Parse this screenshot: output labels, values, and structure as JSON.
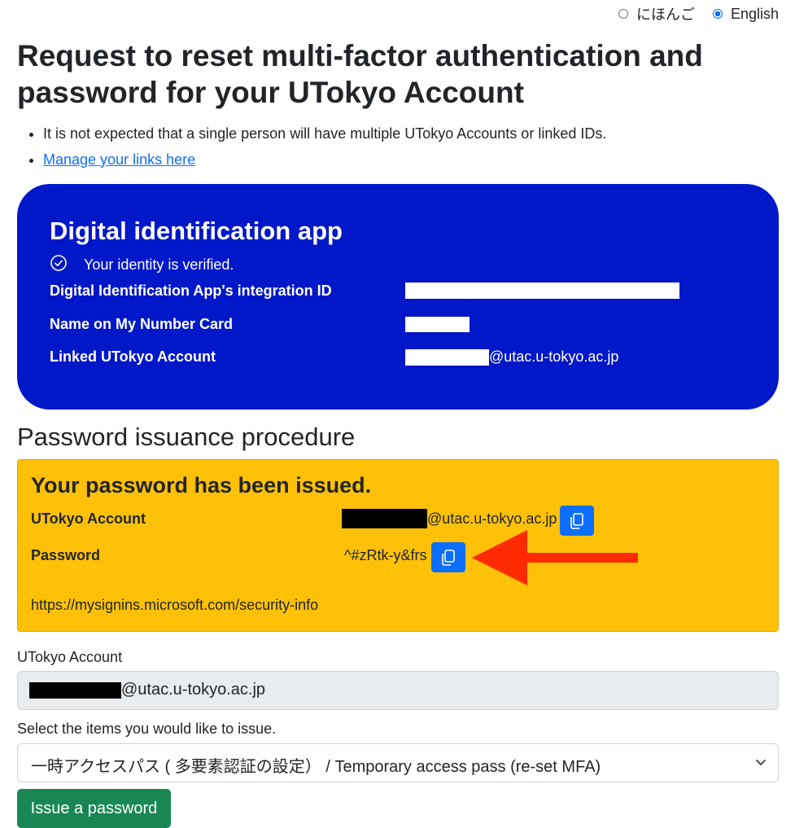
{
  "language": {
    "options": [
      {
        "label": "にほんご",
        "checked": false
      },
      {
        "label": "English",
        "checked": true
      }
    ]
  },
  "page_title": "Request to reset multi-factor authentication and password for your UTokyo Account",
  "notes": {
    "note1": "It is not expected that a single person will have multiple UTokyo Accounts or linked IDs.",
    "link": "Manage your links here"
  },
  "digital_app": {
    "title": "Digital identification app",
    "verified_text": "Your identity is verified.",
    "integration_id_label": "Digital Identification App's integration ID",
    "name_label": "Name on My Number Card",
    "linked_account_label": "Linked UTokyo Account",
    "linked_account_domain": "@utac.u-tokyo.ac.jp"
  },
  "procedure": {
    "heading": "Password issuance procedure",
    "issued_title": "Your password has been issued.",
    "account_label": "UTokyo Account",
    "account_domain": "@utac.u-tokyo.ac.jp",
    "password_label": "Password",
    "password_value": "^#zRtk-y&frs",
    "url": "https://mysignins.microsoft.com/security-info"
  },
  "form": {
    "account_label": "UTokyo Account",
    "account_domain": "@utac.u-tokyo.ac.jp",
    "select_label": "Select the items you would like to issue.",
    "select_value": "一時アクセスパス ( 多要素認証の設定） / Temporary access pass (re-set MFA)",
    "issue_button": "Issue a password"
  },
  "colors": {
    "digital_bg": "#0018c8",
    "issued_bg": "#ffc107",
    "copy_button": "#0d6efd",
    "issue_button": "#198754",
    "arrow": "#ff2a00"
  },
  "icons": [
    "check-circle-icon",
    "copy-icon",
    "chevron-down-icon",
    "red-arrow"
  ]
}
